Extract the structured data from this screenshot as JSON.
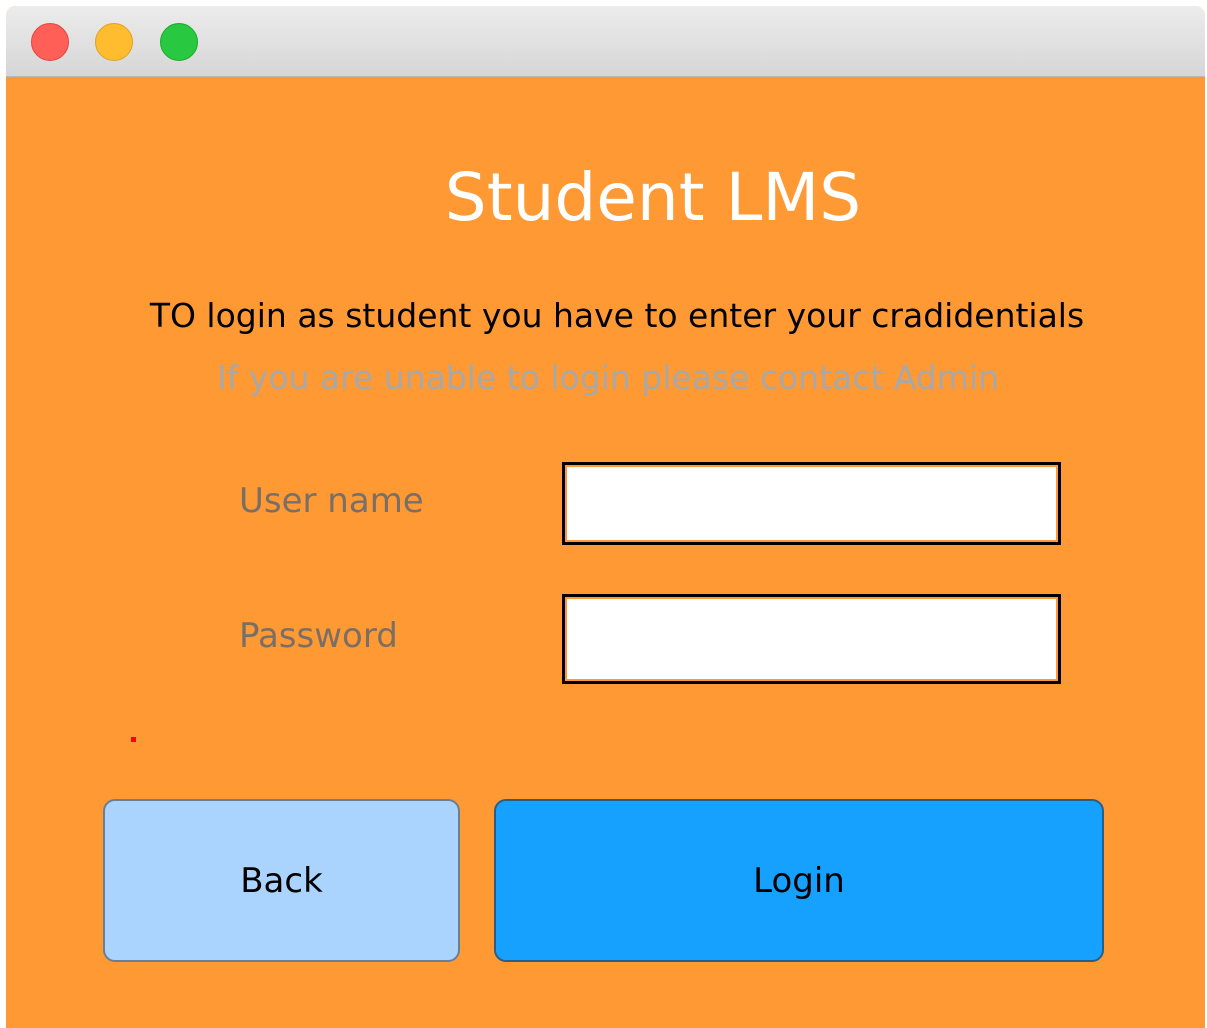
{
  "window": {
    "controls": [
      "close",
      "minimize",
      "zoom"
    ]
  },
  "app": {
    "title": "Student LMS",
    "instructions": "TO login as student you have to enter your cradidentials",
    "help_text": "If you are unable to login please contact Admin"
  },
  "form": {
    "username_label": "User name",
    "username_value": "",
    "password_label": "Password",
    "password_value": ""
  },
  "buttons": {
    "back_label": "Back",
    "login_label": "Login"
  },
  "colors": {
    "background": "#ff9933",
    "title_text": "#ffffff",
    "help_text": "#a8a8a8",
    "back_button": "#aad3fd",
    "login_button": "#16a1ff",
    "error_indicator": "#ff0000"
  }
}
